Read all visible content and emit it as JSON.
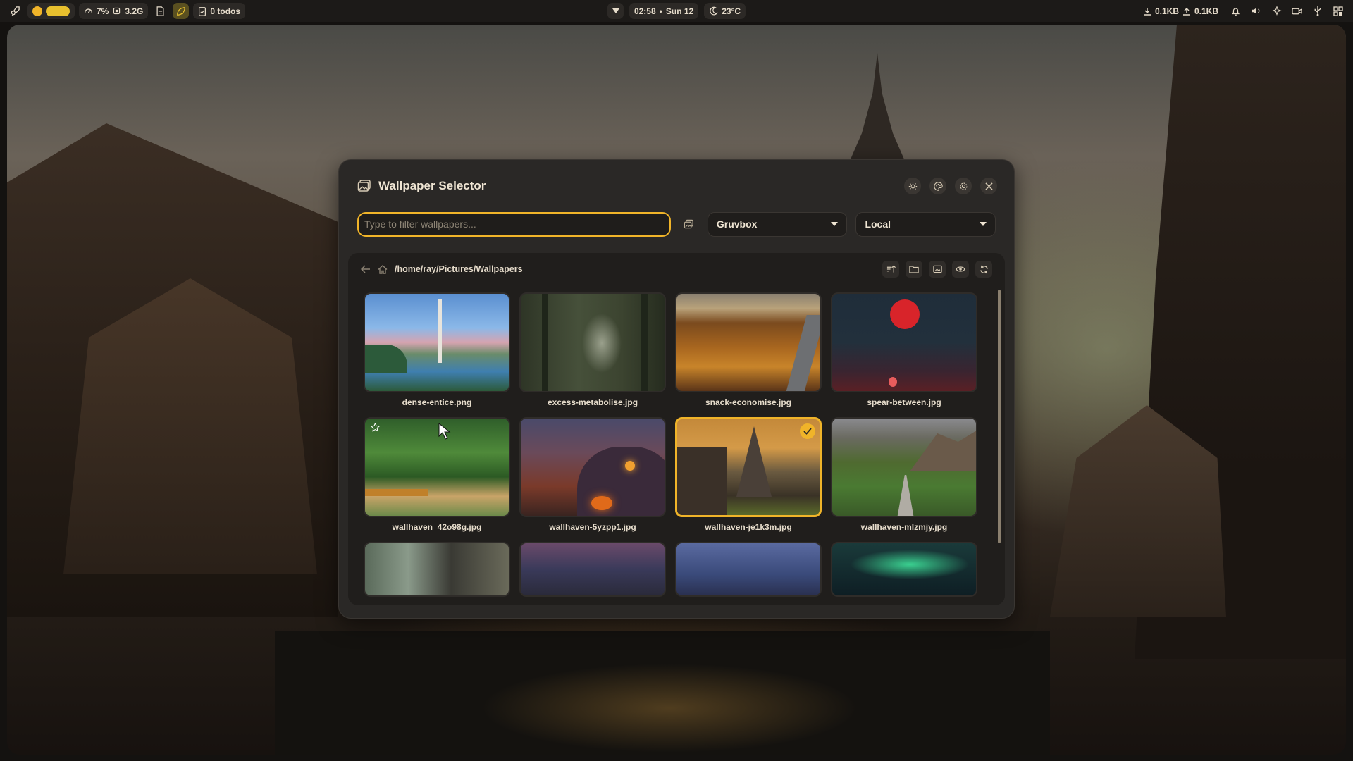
{
  "topbar": {
    "cpu": "7%",
    "memory": "3.2G",
    "todos": "0 todos",
    "time": "02:58",
    "separator": "•",
    "date": "Sun 12",
    "weather": "23°C",
    "download": "0.1KB",
    "upload": "0.1KB"
  },
  "dialog": {
    "title": "Wallpaper Selector",
    "search_placeholder": "Type to filter wallpapers...",
    "search_value": "",
    "theme_select": "Gruvbox",
    "source_select": "Local",
    "path": "/home/ray/Pictures/Wallpapers"
  },
  "wallpapers": [
    {
      "name": "dense-entice.png",
      "selected": false
    },
    {
      "name": "excess-metabolise.jpg",
      "selected": false
    },
    {
      "name": "snack-economise.jpg",
      "selected": false
    },
    {
      "name": "spear-between.jpg",
      "selected": false
    },
    {
      "name": "wallhaven_42o98g.jpg",
      "selected": false
    },
    {
      "name": "wallhaven-5yzpp1.jpg",
      "selected": false
    },
    {
      "name": "wallhaven-je1k3m.jpg",
      "selected": true
    },
    {
      "name": "wallhaven-mlzmjy.jpg",
      "selected": false
    },
    {
      "name": "",
      "selected": false
    },
    {
      "name": "",
      "selected": false
    },
    {
      "name": "",
      "selected": false
    },
    {
      "name": "",
      "selected": false
    }
  ],
  "colors": {
    "accent": "#f0b429",
    "panel": "#2a2826",
    "panel_dark": "#201e1c",
    "text": "#e6dccb"
  }
}
